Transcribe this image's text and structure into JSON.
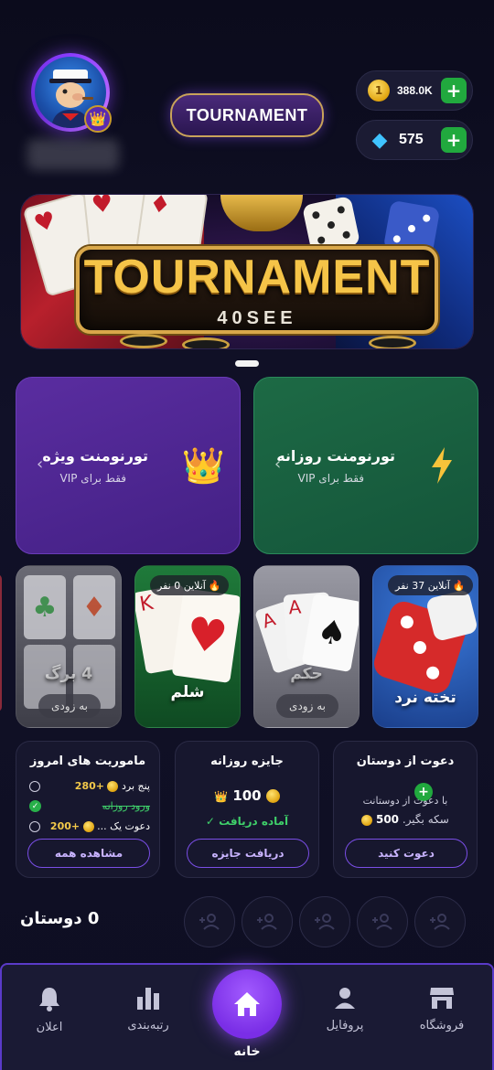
{
  "header": {
    "tournament_label": "TOURNAMENT",
    "coins": "388.0K",
    "gems": "575",
    "plus": "+"
  },
  "banner": {
    "title": "TOURNAMENT",
    "subtitle": "40SEE"
  },
  "promos": {
    "vip": {
      "title": "تورنومنت ویژه",
      "subtitle": "فقط برای VIP"
    },
    "daily": {
      "title": "تورنومنت روزانه",
      "subtitle": "فقط برای VIP"
    }
  },
  "games": [
    {
      "name": "تخته نرد",
      "online": "آنلاین 37 نفر"
    },
    {
      "name": "حکم",
      "status": "به زودی"
    },
    {
      "name": "شلم",
      "online": "آنلاین 0 نفر"
    },
    {
      "name": "4 برگ",
      "status": "به زودی"
    }
  ],
  "invite": {
    "title": "دعوت از دوستان",
    "desc_line1": "با دعوت از دوستانت",
    "amount": "500",
    "desc_line2": "سکه بگیر.",
    "button": "دعوت کنید"
  },
  "daily_reward": {
    "title": "جایزه روزانه",
    "amount": "100",
    "status": "آماده دریافت",
    "button": "دریافت جایزه"
  },
  "missions": {
    "title": "ماموریت های امروز",
    "items": [
      {
        "label": "پنج برد",
        "reward": "+280"
      },
      {
        "label": "ورود روزانه",
        "reward": ""
      },
      {
        "label": "دعوت یک ...",
        "reward": "+200"
      }
    ],
    "button": "مشاهده همه"
  },
  "friends": {
    "count_label": "0 دوستان"
  },
  "nav": {
    "shop": "فروشگاه",
    "profile": "پروفایل",
    "home": "خانه",
    "ranking": "رتبه‌بندی",
    "notifications": "اعلان"
  },
  "colors": {
    "accent_purple": "#7a2ee6",
    "green": "#21a93e",
    "gold": "#f5c448"
  }
}
